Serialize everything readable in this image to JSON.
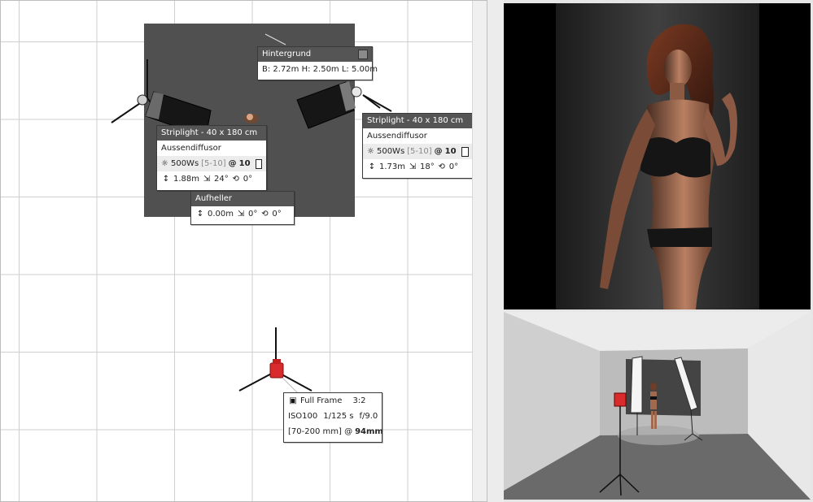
{
  "backdrop_panel": {
    "title": "Hintergrund",
    "dims": "B: 2.72m H: 2.50m L: 5.00m"
  },
  "left_light": {
    "title": "Striplight - 40 x 180 cm",
    "modifier": "Aussendiffusor",
    "power": "500Ws",
    "range": "[5-10]",
    "at": "@",
    "level": "10",
    "height": "1.88m",
    "tilt": "24°",
    "rotation": "0°"
  },
  "right_light": {
    "title": "Striplight - 40 x 180 cm",
    "modifier": "Aussendiffusor",
    "power": "500Ws",
    "range": "[5-10]",
    "at": "@",
    "level": "10",
    "height": "1.73m",
    "tilt": "18°",
    "rotation": "0°"
  },
  "reflector": {
    "title": "Aufheller",
    "height": "0.00m",
    "tilt": "0°",
    "rotation": "0°"
  },
  "camera": {
    "sensor": "Full Frame",
    "ratio": "3:2",
    "iso": "ISO100",
    "shutter": "1/125 s",
    "aperture": "f/9.0",
    "lens": "[70-200 mm] @",
    "focal": "94mm"
  },
  "icons": {
    "color_swatch": "color-swatch",
    "flash": "sun-icon",
    "height": "height-icon",
    "tilt": "tilt-icon",
    "rotation": "rotation-icon",
    "camera": "camera-icon"
  },
  "colors": {
    "camera_body": "#d92b2b",
    "panel_header": "#555555",
    "backdrop": "#505050"
  }
}
